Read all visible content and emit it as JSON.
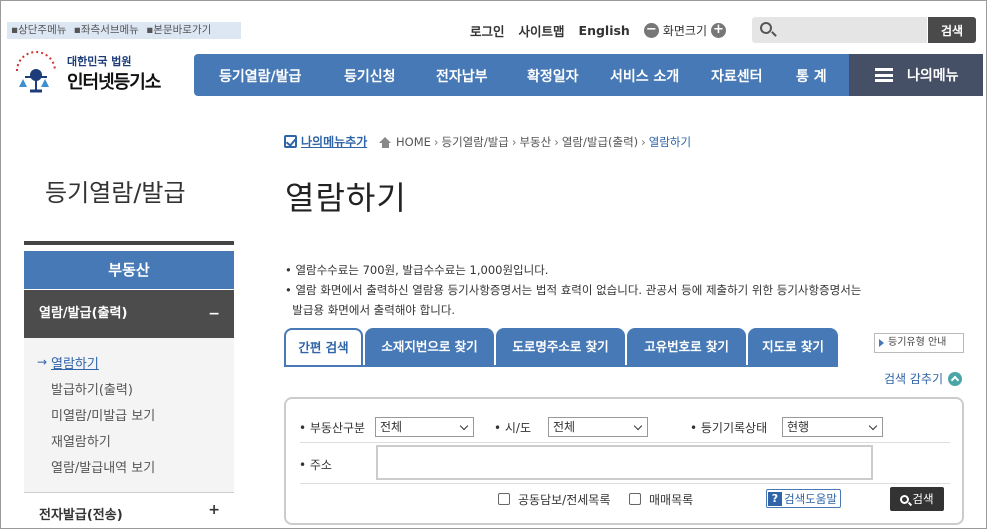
{
  "skip": [
    "▪상단주메뉴",
    "▪좌측서브메뉴",
    "▪본문바로가기"
  ],
  "util": {
    "login": "로그인",
    "sitemap": "사이트맵",
    "english": "English",
    "zoom_label": "화면크기",
    "zoom_minus": "−",
    "zoom_plus": "+"
  },
  "top_search": {
    "placeholder": "",
    "button": "검색"
  },
  "logo": {
    "line1": "대한민국 법원",
    "line2": "인터넷등기소"
  },
  "gnb": [
    "등기열람/발급",
    "등기신청",
    "전자납부",
    "확정일자",
    "서비스 소개",
    "자료센터",
    "통 계"
  ],
  "my_menu": "나의메뉴",
  "lnb": {
    "title": "등기열람/발급",
    "category": "부동산",
    "selected": "열람/발급(출력)",
    "selected_toggle": "−",
    "sub_items": [
      "열람하기",
      "발급하기(출력)",
      "미열람/미발급 보기",
      "재열람하기",
      "열람/발급내역 보기"
    ],
    "sub_arrow": "→",
    "next": "전자발급(전송)",
    "next_toggle": "+"
  },
  "breadcrumb": {
    "add_menu": "나의메뉴추가",
    "items": [
      "HOME",
      "등기열람/발급",
      "부동산",
      "열람/발급(출력)",
      "열람하기"
    ],
    "sep": "›"
  },
  "page_title": "열람하기",
  "notices": [
    "• 열람수수료는 700원, 발급수수료는 1,000원입니다.",
    "• 열람 화면에서 출력하신 열람용 등기사항증명서는 법적 효력이 없습니다. 관공서 등에 제출하기 위한 등기사항증명서는",
    "  발급용 화면에서 출력해야 합니다."
  ],
  "tabs": [
    "간편 검색",
    "소재지번으로 찾기",
    "도로명주소로 찾기",
    "고유번호로 찾기",
    "지도로 찾기"
  ],
  "guide_button": "등기유형 안내",
  "hide_search": "검색 감추기",
  "form": {
    "type_label": "• 부동산구분",
    "type_value": "전체",
    "region_label": "• 시/도",
    "region_value": "전체",
    "status_label": "• 등기기록상태",
    "status_value": "현행",
    "address_label": "• 주소",
    "address_value": "",
    "check1": "공동담보/전세목록",
    "check2": "매매목록",
    "help": "검색도움말",
    "help_icon": "?",
    "search": "검색"
  },
  "colors": {
    "primary": "#4679b5",
    "my_menu": "#454f66",
    "selected": "#4c4c4c",
    "link": "#2f64a8"
  }
}
